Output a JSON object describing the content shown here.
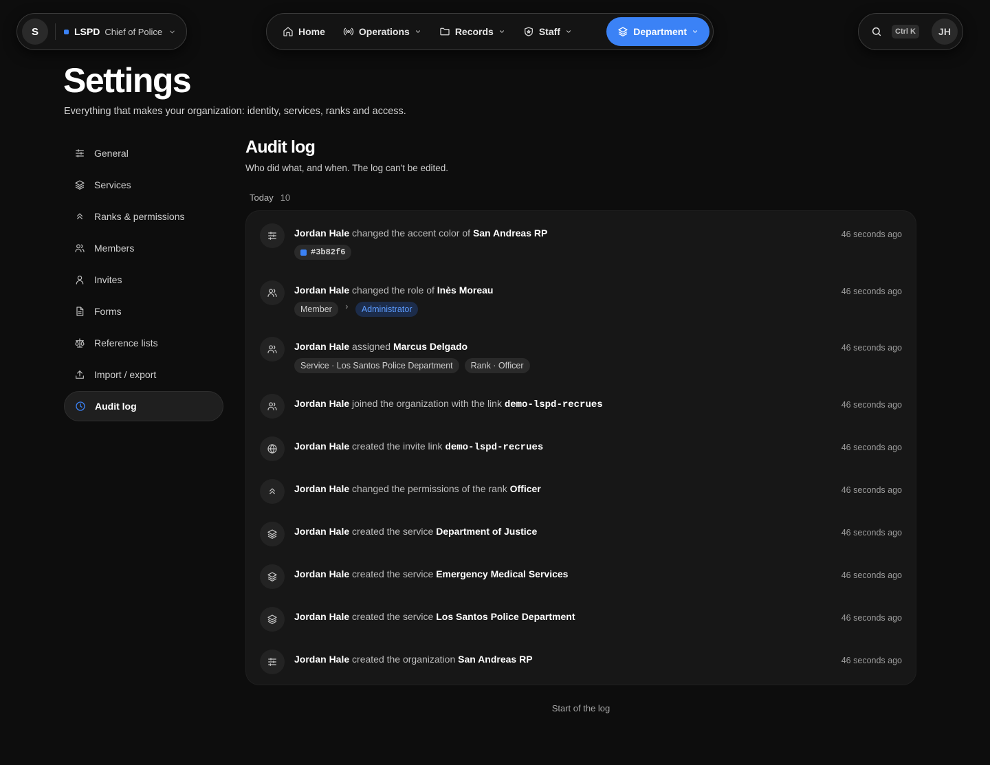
{
  "org": {
    "avatar": "S",
    "name": "LSPD",
    "role": "Chief of Police",
    "accent": "#3b82f6"
  },
  "nav": {
    "items": [
      {
        "label": "Home",
        "icon": "home-icon"
      },
      {
        "label": "Operations",
        "icon": "broadcast-icon"
      },
      {
        "label": "Records",
        "icon": "folder-icon"
      },
      {
        "label": "Staff",
        "icon": "shield-icon"
      },
      {
        "label": "Department",
        "icon": "layers-icon",
        "active": true
      }
    ]
  },
  "utils": {
    "shortcut": "Ctrl K",
    "user_initials": "JH"
  },
  "page": {
    "title": "Settings",
    "subtitle": "Everything that makes your organization: identity, services, ranks and access."
  },
  "sidebar": {
    "items": [
      {
        "label": "General",
        "icon": "sliders-icon"
      },
      {
        "label": "Services",
        "icon": "layers-icon"
      },
      {
        "label": "Ranks & permissions",
        "icon": "chevrons-up-icon"
      },
      {
        "label": "Members",
        "icon": "users-icon"
      },
      {
        "label": "Invites",
        "icon": "user-icon"
      },
      {
        "label": "Forms",
        "icon": "file-icon"
      },
      {
        "label": "Reference lists",
        "icon": "scale-icon"
      },
      {
        "label": "Import / export",
        "icon": "upload-icon"
      },
      {
        "label": "Audit log",
        "icon": "clock-icon",
        "active": true
      }
    ]
  },
  "audit": {
    "title": "Audit log",
    "subtitle": "Who did what, and when. The log can't be edited.",
    "group_label": "Today",
    "group_count": "10",
    "footer": "Start of the log",
    "entries": [
      {
        "icon": "sliders-icon",
        "actor": "Jordan Hale",
        "action": "changed the accent color of",
        "target": "San Andreas RP",
        "time": "46 seconds ago",
        "color_chip": "#3b82f6",
        "color_chip_label": "#3b82f6"
      },
      {
        "icon": "users-icon",
        "actor": "Jordan Hale",
        "action": "changed the role of",
        "target": "Inès Moreau",
        "time": "46 seconds ago",
        "role_from": "Member",
        "role_to": "Administrator"
      },
      {
        "icon": "users-icon",
        "actor": "Jordan Hale",
        "action": "assigned",
        "target": "Marcus Delgado",
        "time": "46 seconds ago",
        "chip_service": "Service · Los Santos Police Department",
        "chip_rank": "Rank · Officer"
      },
      {
        "icon": "users-icon",
        "actor": "Jordan Hale",
        "action": "joined the organization with the link",
        "target": "demo-lspd-recrues",
        "time": "46 seconds ago"
      },
      {
        "icon": "globe-icon",
        "actor": "Jordan Hale",
        "action": "created the invite link",
        "target": "demo-lspd-recrues",
        "time": "46 seconds ago"
      },
      {
        "icon": "chevrons-up-icon",
        "actor": "Jordan Hale",
        "action": "changed the permissions of the rank",
        "target": "Officer",
        "time": "46 seconds ago"
      },
      {
        "icon": "layers-icon",
        "actor": "Jordan Hale",
        "action": "created the service",
        "target": "Department of Justice",
        "time": "46 seconds ago"
      },
      {
        "icon": "layers-icon",
        "actor": "Jordan Hale",
        "action": "created the service",
        "target": "Emergency Medical Services",
        "time": "46 seconds ago"
      },
      {
        "icon": "layers-icon",
        "actor": "Jordan Hale",
        "action": "created the service",
        "target": "Los Santos Police Department",
        "time": "46 seconds ago"
      },
      {
        "icon": "sliders-icon",
        "actor": "Jordan Hale",
        "action": "created the organization",
        "target": "San Andreas RP",
        "time": "46 seconds ago"
      }
    ]
  }
}
